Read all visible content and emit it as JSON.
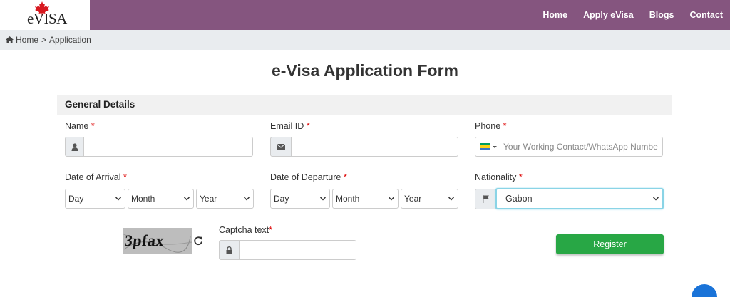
{
  "logo": {
    "text": "eVISA"
  },
  "nav": {
    "items": [
      "Home",
      "Apply eVisa",
      "Blogs",
      "Contact"
    ]
  },
  "breadcrumb": {
    "home": "Home",
    "separator": ">",
    "current": "Application"
  },
  "page_title": "e-Visa Application Form",
  "section": {
    "title": "General Details"
  },
  "fields": {
    "name": {
      "label": "Name",
      "required": "*",
      "value": ""
    },
    "email": {
      "label": "Email ID",
      "required": "*",
      "value": ""
    },
    "phone": {
      "label": "Phone",
      "required": "*",
      "placeholder": "Your Working Contact/WhatsApp Numbe"
    },
    "arrival": {
      "label": "Date of Arrival",
      "required": "*",
      "day": "Day",
      "month": "Month",
      "year": "Year"
    },
    "departure": {
      "label": "Date of Departure",
      "required": "*",
      "day": "Day",
      "month": "Month",
      "year": "Year"
    },
    "nationality": {
      "label": "Nationality",
      "required": "*",
      "selected": "Gabon"
    },
    "captcha": {
      "label": "Captcha text",
      "required": "*",
      "image_text": "3pfax",
      "value": ""
    }
  },
  "buttons": {
    "register": "Register"
  },
  "colors": {
    "header": "#85557f",
    "primary_button": "#28a745",
    "required": "#dd0000",
    "focus_border": "#8ad4e6"
  },
  "icons": [
    "maple-leaf-icon",
    "home-icon",
    "user-icon",
    "envelope-icon",
    "gabon-flag-icon",
    "flag-icon",
    "refresh-icon",
    "lock-icon",
    "chat-icon"
  ]
}
